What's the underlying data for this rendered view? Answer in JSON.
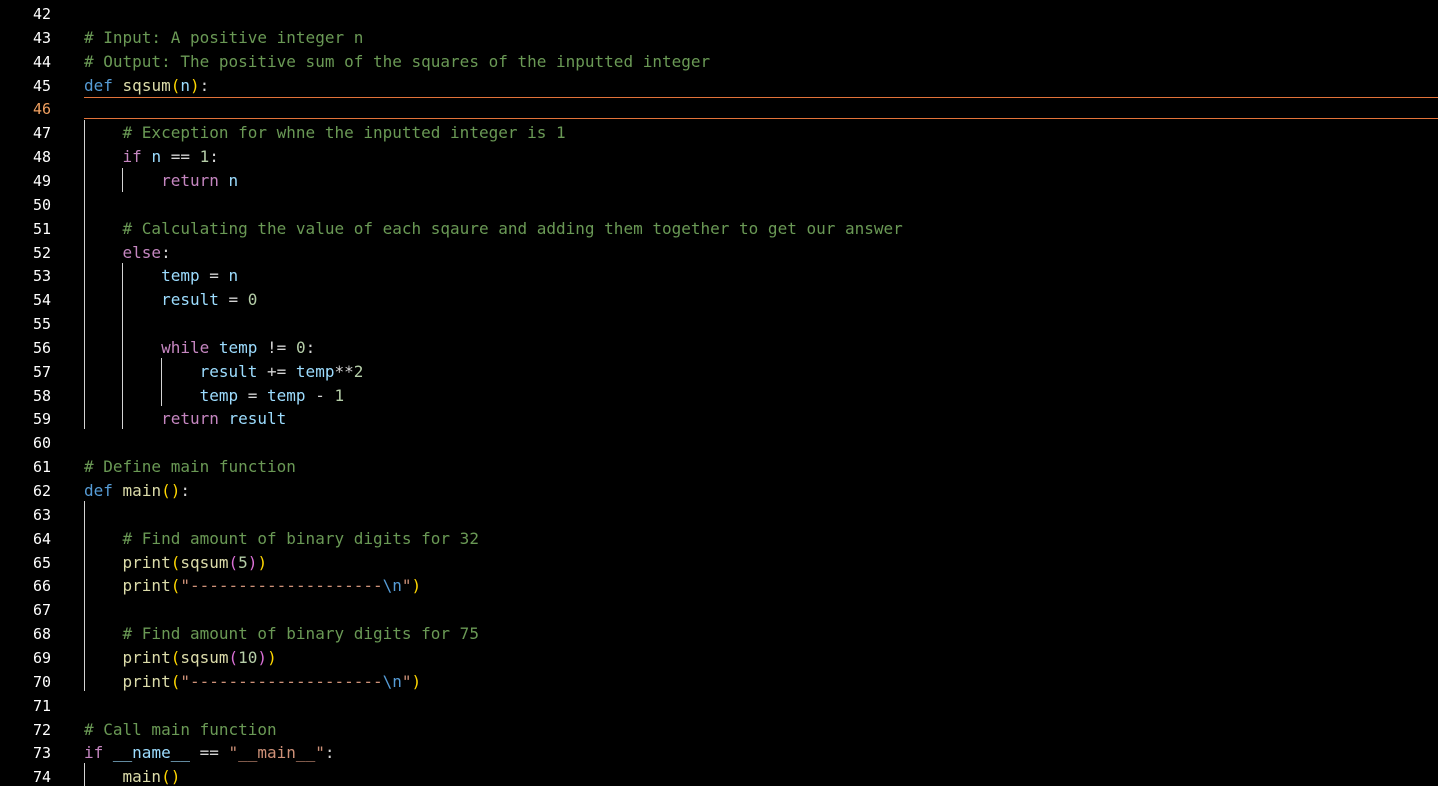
{
  "editor": {
    "active_line": "46",
    "lines": [
      {
        "num": "42",
        "tokens": []
      },
      {
        "num": "43",
        "tokens": [
          {
            "t": "# Input: A positive integer n",
            "c": "cm"
          }
        ]
      },
      {
        "num": "44",
        "tokens": [
          {
            "t": "# Output: The positive sum of the squares of the inputted integer",
            "c": "cm"
          }
        ]
      },
      {
        "num": "45",
        "tokens": [
          {
            "t": "def",
            "c": "kw"
          },
          {
            "t": " ",
            "c": "op"
          },
          {
            "t": "sqsum",
            "c": "fn"
          },
          {
            "t": "(",
            "c": "p1"
          },
          {
            "t": "n",
            "c": "var"
          },
          {
            "t": ")",
            "c": "p1"
          },
          {
            "t": ":",
            "c": "op"
          }
        ]
      },
      {
        "num": "46",
        "tokens": []
      },
      {
        "num": "47",
        "tokens": [
          {
            "t": "    ",
            "c": "op"
          },
          {
            "t": "# Exception for whne the inputted integer is 1",
            "c": "cm"
          }
        ]
      },
      {
        "num": "48",
        "tokens": [
          {
            "t": "    ",
            "c": "op"
          },
          {
            "t": "if",
            "c": "ctl"
          },
          {
            "t": " ",
            "c": "op"
          },
          {
            "t": "n",
            "c": "var"
          },
          {
            "t": " == ",
            "c": "op"
          },
          {
            "t": "1",
            "c": "num"
          },
          {
            "t": ":",
            "c": "op"
          }
        ]
      },
      {
        "num": "49",
        "tokens": [
          {
            "t": "        ",
            "c": "op"
          },
          {
            "t": "return",
            "c": "ctl"
          },
          {
            "t": " ",
            "c": "op"
          },
          {
            "t": "n",
            "c": "var"
          }
        ]
      },
      {
        "num": "50",
        "tokens": []
      },
      {
        "num": "51",
        "tokens": [
          {
            "t": "    ",
            "c": "op"
          },
          {
            "t": "# Calculating the value of each sqaure and adding them together to get our answer",
            "c": "cm"
          }
        ]
      },
      {
        "num": "52",
        "tokens": [
          {
            "t": "    ",
            "c": "op"
          },
          {
            "t": "else",
            "c": "ctl"
          },
          {
            "t": ":",
            "c": "op"
          }
        ]
      },
      {
        "num": "53",
        "tokens": [
          {
            "t": "        ",
            "c": "op"
          },
          {
            "t": "temp",
            "c": "var"
          },
          {
            "t": " = ",
            "c": "op"
          },
          {
            "t": "n",
            "c": "var"
          }
        ]
      },
      {
        "num": "54",
        "tokens": [
          {
            "t": "        ",
            "c": "op"
          },
          {
            "t": "result",
            "c": "var"
          },
          {
            "t": " = ",
            "c": "op"
          },
          {
            "t": "0",
            "c": "num"
          }
        ]
      },
      {
        "num": "55",
        "tokens": []
      },
      {
        "num": "56",
        "tokens": [
          {
            "t": "        ",
            "c": "op"
          },
          {
            "t": "while",
            "c": "ctl"
          },
          {
            "t": " ",
            "c": "op"
          },
          {
            "t": "temp",
            "c": "var"
          },
          {
            "t": " != ",
            "c": "op"
          },
          {
            "t": "0",
            "c": "num"
          },
          {
            "t": ":",
            "c": "op"
          }
        ]
      },
      {
        "num": "57",
        "tokens": [
          {
            "t": "            ",
            "c": "op"
          },
          {
            "t": "result",
            "c": "var"
          },
          {
            "t": " += ",
            "c": "op"
          },
          {
            "t": "temp",
            "c": "var"
          },
          {
            "t": "**",
            "c": "op"
          },
          {
            "t": "2",
            "c": "num"
          }
        ]
      },
      {
        "num": "58",
        "tokens": [
          {
            "t": "            ",
            "c": "op"
          },
          {
            "t": "temp",
            "c": "var"
          },
          {
            "t": " = ",
            "c": "op"
          },
          {
            "t": "temp",
            "c": "var"
          },
          {
            "t": " - ",
            "c": "op"
          },
          {
            "t": "1",
            "c": "num"
          }
        ]
      },
      {
        "num": "59",
        "tokens": [
          {
            "t": "        ",
            "c": "op"
          },
          {
            "t": "return",
            "c": "ctl"
          },
          {
            "t": " ",
            "c": "op"
          },
          {
            "t": "result",
            "c": "var"
          }
        ]
      },
      {
        "num": "60",
        "tokens": []
      },
      {
        "num": "61",
        "tokens": [
          {
            "t": "# Define main function",
            "c": "cm"
          }
        ]
      },
      {
        "num": "62",
        "tokens": [
          {
            "t": "def",
            "c": "kw"
          },
          {
            "t": " ",
            "c": "op"
          },
          {
            "t": "main",
            "c": "fn"
          },
          {
            "t": "(",
            "c": "p1"
          },
          {
            "t": ")",
            "c": "p1"
          },
          {
            "t": ":",
            "c": "op"
          }
        ]
      },
      {
        "num": "63",
        "tokens": []
      },
      {
        "num": "64",
        "tokens": [
          {
            "t": "    ",
            "c": "op"
          },
          {
            "t": "# Find amount of binary digits for 32",
            "c": "cm"
          }
        ]
      },
      {
        "num": "65",
        "tokens": [
          {
            "t": "    ",
            "c": "op"
          },
          {
            "t": "print",
            "c": "fn"
          },
          {
            "t": "(",
            "c": "p1"
          },
          {
            "t": "sqsum",
            "c": "fn"
          },
          {
            "t": "(",
            "c": "p2"
          },
          {
            "t": "5",
            "c": "num"
          },
          {
            "t": ")",
            "c": "p2"
          },
          {
            "t": ")",
            "c": "p1"
          }
        ]
      },
      {
        "num": "66",
        "tokens": [
          {
            "t": "    ",
            "c": "op"
          },
          {
            "t": "print",
            "c": "fn"
          },
          {
            "t": "(",
            "c": "p1"
          },
          {
            "t": "\"--------------------",
            "c": "str"
          },
          {
            "t": "\\n",
            "c": "esc"
          },
          {
            "t": "\"",
            "c": "str"
          },
          {
            "t": ")",
            "c": "p1"
          }
        ]
      },
      {
        "num": "67",
        "tokens": []
      },
      {
        "num": "68",
        "tokens": [
          {
            "t": "    ",
            "c": "op"
          },
          {
            "t": "# Find amount of binary digits for 75",
            "c": "cm"
          }
        ]
      },
      {
        "num": "69",
        "tokens": [
          {
            "t": "    ",
            "c": "op"
          },
          {
            "t": "print",
            "c": "fn"
          },
          {
            "t": "(",
            "c": "p1"
          },
          {
            "t": "sqsum",
            "c": "fn"
          },
          {
            "t": "(",
            "c": "p2"
          },
          {
            "t": "10",
            "c": "num"
          },
          {
            "t": ")",
            "c": "p2"
          },
          {
            "t": ")",
            "c": "p1"
          }
        ]
      },
      {
        "num": "70",
        "tokens": [
          {
            "t": "    ",
            "c": "op"
          },
          {
            "t": "print",
            "c": "fn"
          },
          {
            "t": "(",
            "c": "p1"
          },
          {
            "t": "\"--------------------",
            "c": "str"
          },
          {
            "t": "\\n",
            "c": "esc"
          },
          {
            "t": "\"",
            "c": "str"
          },
          {
            "t": ")",
            "c": "p1"
          }
        ]
      },
      {
        "num": "71",
        "tokens": []
      },
      {
        "num": "72",
        "tokens": [
          {
            "t": "# Call main function",
            "c": "cm"
          }
        ]
      },
      {
        "num": "73",
        "tokens": [
          {
            "t": "if",
            "c": "ctl"
          },
          {
            "t": " ",
            "c": "op"
          },
          {
            "t": "__name__",
            "c": "var"
          },
          {
            "t": " == ",
            "c": "op"
          },
          {
            "t": "\"__main__\"",
            "c": "str"
          },
          {
            "t": ":",
            "c": "op"
          }
        ]
      },
      {
        "num": "74",
        "tokens": [
          {
            "t": "    ",
            "c": "op"
          },
          {
            "t": "main",
            "c": "fn"
          },
          {
            "t": "(",
            "c": "p1"
          },
          {
            "t": ")",
            "c": "p1"
          }
        ]
      }
    ]
  },
  "colors": {
    "background": "#000000",
    "comment": "#6a9955",
    "keyword": "#569cd6",
    "control": "#c586c0",
    "function": "#dcdcaa",
    "variable": "#9cdcfe",
    "number": "#b5cea8",
    "string": "#ce9178",
    "cursor_line_border": "#e2733a"
  }
}
